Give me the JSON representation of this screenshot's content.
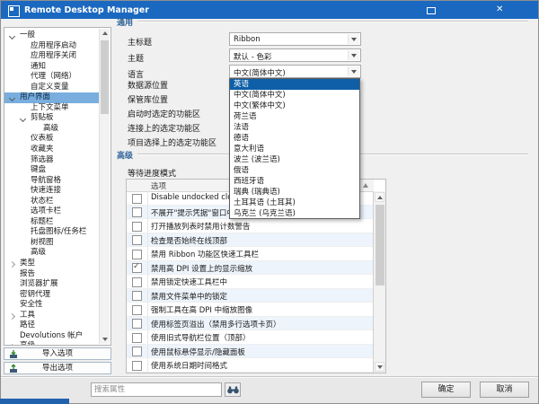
{
  "window": {
    "title": "Remote Desktop Manager"
  },
  "sidebar": {
    "tree": [
      {
        "label": "一般",
        "level": 0,
        "arrow": "down"
      },
      {
        "label": "应用程序启动",
        "level": 1
      },
      {
        "label": "应用程序关闭",
        "level": 1
      },
      {
        "label": "通知",
        "level": 1
      },
      {
        "label": "代理（网络）",
        "level": 1
      },
      {
        "label": "自定义变量",
        "level": 1
      },
      {
        "label": "用户界面",
        "level": 0,
        "arrow": "down",
        "selected": true
      },
      {
        "label": "上下文菜单",
        "level": 1
      },
      {
        "label": "剪贴板",
        "level": 1,
        "arrow": "down"
      },
      {
        "label": "高级",
        "level": 2
      },
      {
        "label": "仪表板",
        "level": 1
      },
      {
        "label": "收藏夹",
        "level": 1
      },
      {
        "label": "筛选器",
        "level": 1
      },
      {
        "label": "键盘",
        "level": 1
      },
      {
        "label": "导航窗格",
        "level": 1
      },
      {
        "label": "快速连接",
        "level": 1
      },
      {
        "label": "状态栏",
        "level": 1
      },
      {
        "label": "选项卡栏",
        "level": 1
      },
      {
        "label": "标题栏",
        "level": 1
      },
      {
        "label": "托盘图标/任务栏",
        "level": 1
      },
      {
        "label": "树视图",
        "level": 1
      },
      {
        "label": "高级",
        "level": 1
      },
      {
        "label": "类型",
        "level": 0,
        "arrow": "right"
      },
      {
        "label": "报告",
        "level": 0
      },
      {
        "label": "浏览器扩展",
        "level": 0
      },
      {
        "label": "密钥代理",
        "level": 0
      },
      {
        "label": "安全性",
        "level": 0
      },
      {
        "label": "工具",
        "level": 0,
        "arrow": "right"
      },
      {
        "label": "路径",
        "level": 0
      },
      {
        "label": "Devolutions 帐户",
        "level": 0
      },
      {
        "label": "高级",
        "level": 0,
        "arrow": "right"
      }
    ],
    "import_label": "导入选项",
    "export_label": "导出选项"
  },
  "general": {
    "section_title": "通用",
    "fields": [
      {
        "label": "主标题",
        "value": "Ribbon"
      },
      {
        "label": "主题",
        "value": "默认 - 色彩"
      },
      {
        "label": "语言",
        "value": "中文(简体中文)"
      },
      {
        "label": "数据源位置",
        "value": ""
      },
      {
        "label": "保管库位置",
        "value": ""
      },
      {
        "label": "启动时选定的功能区",
        "value": ""
      },
      {
        "label": "连接上的选定功能区",
        "value": ""
      },
      {
        "label": "项目选择上的选定功能区",
        "value": ""
      }
    ]
  },
  "advanced": {
    "section_title": "高级",
    "wait_label": "等待进度模式"
  },
  "language_dropdown": {
    "selected": "英语",
    "items": [
      "英语",
      "中文(简体中文)",
      "中文(繁体中文)",
      "荷兰语",
      "法语",
      "德语",
      "意大利语",
      "波兰 (波兰语)",
      "俄语",
      "西班牙语",
      "瑞典 (瑞典语)",
      "土耳其语 (土耳其)",
      "乌克兰 (乌克兰语)"
    ]
  },
  "options_table": {
    "header": "选项",
    "rows": [
      {
        "label": "Disable undocked close button",
        "checked": false
      },
      {
        "label": "不展开\"提示凭据\"窗口中的文件",
        "checked": false
      },
      {
        "label": "打开播放列表时禁用计数警告",
        "checked": false
      },
      {
        "label": "检查是否始终在线顶部",
        "checked": false
      },
      {
        "label": "禁用 Ribbon 功能区快速工具栏",
        "checked": false
      },
      {
        "label": "禁用高 DPI 设置上的显示缩放",
        "checked": true
      },
      {
        "label": "禁用锁定快速工具栏中",
        "checked": false
      },
      {
        "label": "禁用文件菜单中的锁定",
        "checked": false
      },
      {
        "label": "强制工具在高 DPI 中缩放图像",
        "checked": false
      },
      {
        "label": "使用标签页溢出（禁用多行选项卡页）",
        "checked": false
      },
      {
        "label": "使用旧式导航栏位置（顶部）",
        "checked": false
      },
      {
        "label": "使用鼠标悬停显示/隐藏面板",
        "checked": false
      },
      {
        "label": "使用系统日期时间格式",
        "checked": false
      }
    ]
  },
  "footer": {
    "search_placeholder": "搜索属性",
    "ok_label": "确定",
    "cancel_label": "取消"
  },
  "colors": {
    "titlebar": "#1a68c0",
    "tree_selection": "#79aede",
    "dropdown_highlight": "#0e5fa8",
    "section_header": "#336699"
  }
}
